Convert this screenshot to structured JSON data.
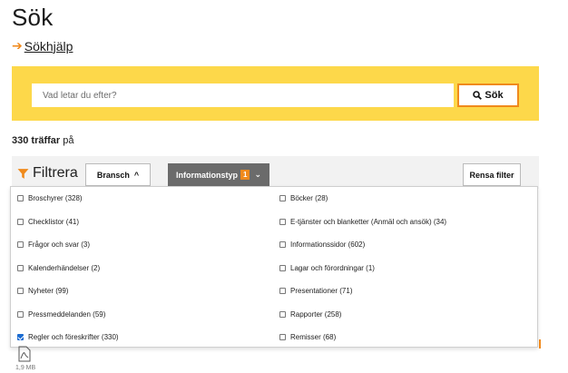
{
  "page": {
    "title": "Sök"
  },
  "help": {
    "label": "Sökhjälp"
  },
  "search": {
    "placeholder": "Vad letar du efter?",
    "button_label": "Sök"
  },
  "results": {
    "count": "330 träffar",
    "suffix": "på"
  },
  "filter": {
    "title": "Filtrera",
    "bransch_label": "Bransch",
    "infotyp_label": "Informationstyp",
    "infotyp_count": "1",
    "clear_label": "Rensa filter"
  },
  "options": [
    {
      "label": "Broschyrer (328)",
      "checked": false
    },
    {
      "label": "Böcker (28)",
      "checked": false
    },
    {
      "label": "Checklistor (41)",
      "checked": false
    },
    {
      "label": "E-tjänster och blanketter (Anmäl och ansök) (34)",
      "checked": false
    },
    {
      "label": "Frågor och svar (3)",
      "checked": false
    },
    {
      "label": "Informationssidor (602)",
      "checked": false
    },
    {
      "label": "Kalenderhändelser (2)",
      "checked": false
    },
    {
      "label": "Lagar och förordningar (1)",
      "checked": false
    },
    {
      "label": "Nyheter (99)",
      "checked": false
    },
    {
      "label": "Presentationer (71)",
      "checked": false
    },
    {
      "label": "Pressmeddelanden (59)",
      "checked": false
    },
    {
      "label": "Rapporter (258)",
      "checked": false
    },
    {
      "label": "Regler och föreskrifter (330)",
      "checked": true
    },
    {
      "label": "Remisser (68)",
      "checked": false
    }
  ],
  "result_item": {
    "filesize": "1,9 MB"
  },
  "colors": {
    "accent": "#f08a1c",
    "band": "#fdd84a",
    "active_pill": "#6b6b6b",
    "checkbox": "#1a6bd1"
  }
}
